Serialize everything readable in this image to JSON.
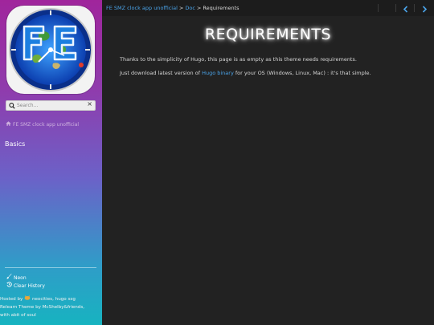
{
  "sidebar": {
    "logo_text": "FE",
    "search": {
      "placeholder": "Search...",
      "clear": "×"
    },
    "home_link": "FE SMZ clock app unofficial",
    "menu": [
      {
        "label": "Basics"
      }
    ],
    "tools": {
      "neon": "Neon",
      "clear_history": "Clear History"
    },
    "footer": {
      "hosted_by": "Hosted by",
      "neocities": "neocities",
      "sep1": ",",
      "hugo": "hugo ssg",
      "line2": "Relearn Theme by McShelby&friends,",
      "line3": "with abit of soul"
    }
  },
  "breadcrumb": {
    "root": "FE SMZ clock app unofficial",
    "sep": ">",
    "parent": "Doc",
    "current": "Requirements"
  },
  "nav": {
    "prev": "previous-page",
    "next": "next-page"
  },
  "page": {
    "title": "REQUIREMENTS",
    "p1": "Thanks to the simplicity of Hugo, this page is as empty as this theme needs requirements.",
    "p2_before": "Just download latest version of ",
    "p2_link": "Hugo binary",
    "p2_after": " for your OS (Windows, Linux, Mac) : it's that simple."
  },
  "colors": {
    "accent": "#4aa3e8",
    "sidebar_top": "#a0259c",
    "sidebar_bottom": "#17b3c0",
    "content_bg": "#222222"
  }
}
